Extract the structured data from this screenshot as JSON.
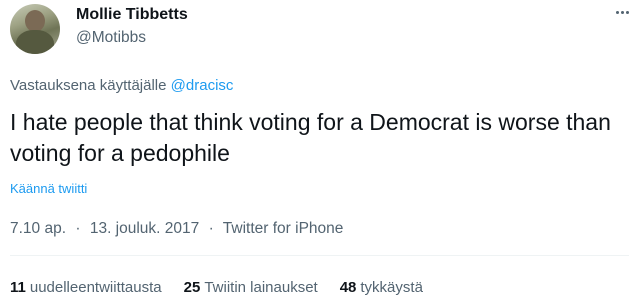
{
  "author": {
    "display_name": "Mollie Tibbetts",
    "handle": "@Motibbs"
  },
  "reply_context": {
    "prefix": "Vastauksena käyttäjälle",
    "mention": "@dracisc"
  },
  "tweet": {
    "text": "I hate people that think voting for a Democrat is worse than voting for a pedophile",
    "translate_label": "Käännä twiitti"
  },
  "meta": {
    "time": "7.10 ap.",
    "date": "13. jouluk. 2017",
    "source": "Twitter for iPhone",
    "separator": "·"
  },
  "stats": {
    "retweets": {
      "count": "11",
      "label": "uudelleentwiittausta"
    },
    "quotes": {
      "count": "25",
      "label": "Twiitin lainaukset"
    },
    "likes": {
      "count": "48",
      "label": "tykkäystä"
    }
  },
  "icons": {
    "more": "more-horizontal-icon"
  },
  "colors": {
    "accent": "#1d9bf0",
    "secondary_text": "#536471",
    "primary_text": "#0f1419"
  }
}
